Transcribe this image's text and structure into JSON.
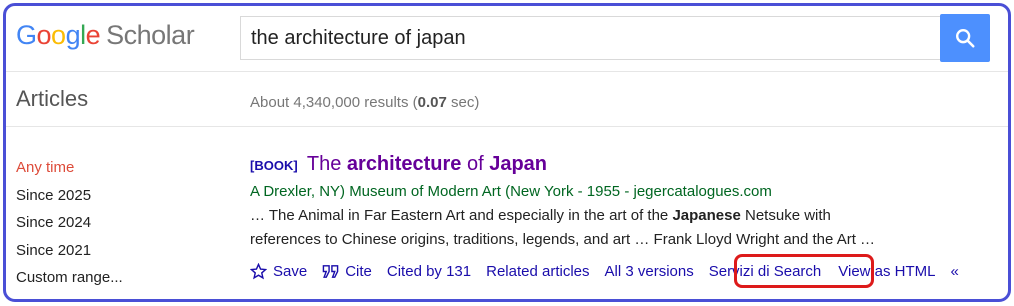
{
  "logo": {
    "google": [
      "G",
      "o",
      "o",
      "g",
      "l",
      "e"
    ],
    "product": "Scholar"
  },
  "search": {
    "query": "the architecture of japan"
  },
  "header": {
    "section": "Articles",
    "results_prefix": "About 4,340,000 results (",
    "results_time": "0.07",
    "results_suffix": " sec)"
  },
  "sidebar": {
    "items": [
      "Any time",
      "Since 2025",
      "Since 2024",
      "Since 2021",
      "Custom range..."
    ]
  },
  "result": {
    "tag": "[BOOK]",
    "title_parts": [
      "The ",
      "architecture",
      " of ",
      "Japan"
    ],
    "authors": "A Drexler, NY) Museum of Modern Art (New York - 1955 - jegercatalogues.com",
    "snippet_1a": "… The Animal in Far Eastern Art and especially in the art of the ",
    "snippet_1b": "Japanese",
    "snippet_1c": " Netsuke with",
    "snippet_2": "references to Chinese origins, traditions, legends, and art … Frank Lloyd Wright and the Art …"
  },
  "actions": {
    "save": "Save",
    "cite": "Cite",
    "cited_by": "Cited by 131",
    "related": "Related articles",
    "versions": "All 3 versions",
    "servizi": "Servizi di Search",
    "view_html": "View as HTML"
  },
  "colors": {
    "accent": "#4d90fe",
    "link": "#1a0dab",
    "visited": "#660099",
    "green": "#006621",
    "highlight": "#dd1a1a",
    "frame": "#4a4fd6"
  }
}
